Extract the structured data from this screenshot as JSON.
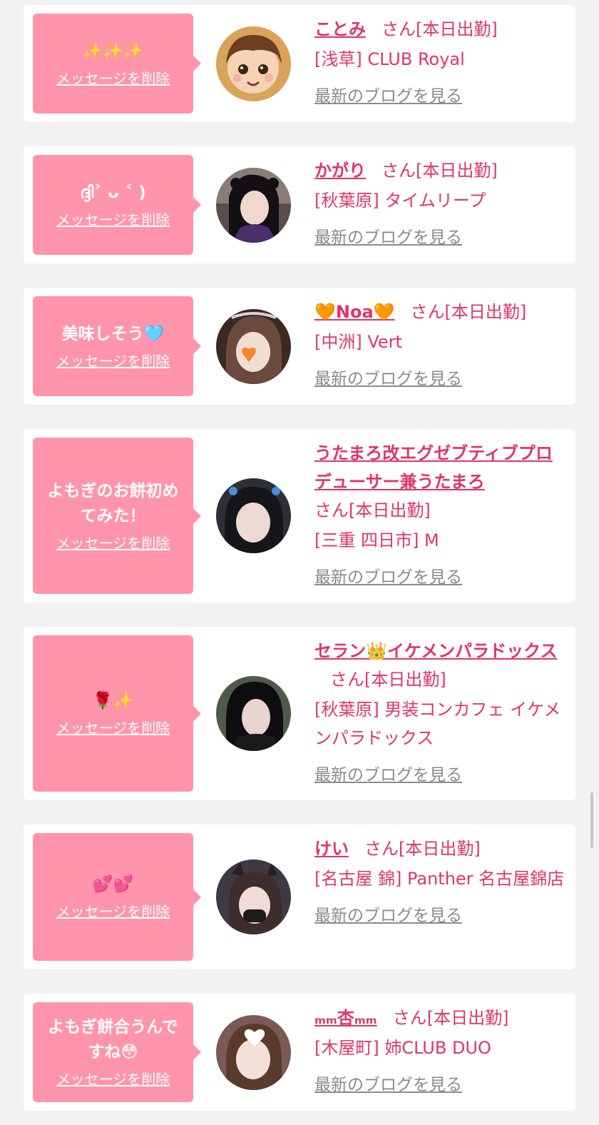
{
  "labels": {
    "delete": "メッセージを削除",
    "blog": "最新のブログを見る",
    "san": "さん[本日出勤]"
  },
  "entries": [
    {
      "message": "✨✨✨",
      "name": "ことみ",
      "shop": "[浅草] CLUB Royal",
      "avatar": "avatar-illustration"
    },
    {
      "message": "ദ്ദി˃ ᴗ ˂ )",
      "name": "かがり",
      "shop": "[秋葉原] タイムリープ",
      "avatar": "avatar-photo"
    },
    {
      "message": "美味しそう🩵",
      "name": "🧡Noa🧡",
      "shop": "[中洲] Vert",
      "avatar": "avatar-photo"
    },
    {
      "message": "よもぎのお餅初めてみた！",
      "name": "うたまろ改エグゼブティブプロデューサー兼うたまろ",
      "shop": "[三重 四日市] M",
      "avatar": "avatar-photo"
    },
    {
      "message": "🌹✨",
      "name": "セラン👑イケメンパラドックス",
      "shop": "[秋葉原] 男装コンカフェ イケメンパラドックス",
      "avatar": "avatar-photo"
    },
    {
      "message": "💕💕",
      "name": "けい",
      "shop": "[名古屋 錦] Panther 名古屋錦店",
      "avatar": "avatar-photo"
    },
    {
      "message": "よもぎ餅合うんですね😳",
      "name": "ₘₘ杏ₘₘ",
      "shop": "[木屋町] 姉CLUB DUO",
      "avatar": "avatar-photo"
    }
  ]
}
